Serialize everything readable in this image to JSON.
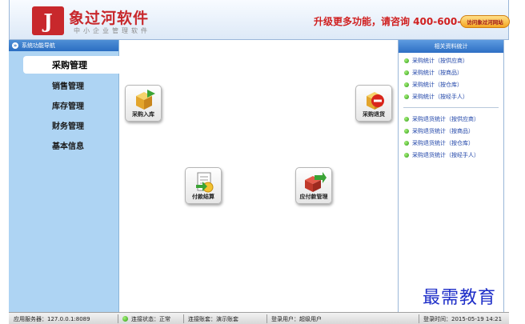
{
  "header": {
    "logo_title": "象过河软件",
    "logo_subtitle": "中小企业管理软件",
    "promo": "升级更多功能，请咨询 400-600-1168",
    "visit_button": "访问象过河网站"
  },
  "nav": {
    "header": "系统功能导航",
    "items": [
      {
        "label": "采购管理"
      },
      {
        "label": "销售管理"
      },
      {
        "label": "库存管理"
      },
      {
        "label": "财务管理"
      },
      {
        "label": "基本信息"
      }
    ]
  },
  "main": {
    "tiles": [
      {
        "label": "采购入库",
        "icon": "purchase-in-icon"
      },
      {
        "label": "采购退货",
        "icon": "purchase-return-icon"
      },
      {
        "label": "付款结算",
        "icon": "payment-settlement-icon"
      },
      {
        "label": "应付款管理",
        "icon": "accounts-payable-icon"
      }
    ]
  },
  "right_panel": {
    "title": "相关资料统计",
    "group1": [
      {
        "label": "采购统计（按供应商）"
      },
      {
        "label": "采购统计（按商品）"
      },
      {
        "label": "采购统计（按仓库）"
      },
      {
        "label": "采购统计（按经手人）"
      }
    ],
    "group2": [
      {
        "label": "采购退货统计（按供应商）"
      },
      {
        "label": "采购退货统计（按商品）"
      },
      {
        "label": "采购退货统计（按仓库）"
      },
      {
        "label": "采购退货统计（按经手人）"
      }
    ]
  },
  "watermark": "最需教育",
  "statusbar": {
    "server": "应用服务器：127.0.0.1:8089",
    "connection": "连接状态：正常",
    "account": "连接账套：演示账套",
    "user": "登录用户：超级用户",
    "login_time": "登录时间：2015-05-19 14:21"
  },
  "colors": {
    "brand_red": "#c8282c",
    "nav_bg": "#aed4f3",
    "header_blue": "#2b6ec2",
    "link_blue": "#1f44a8"
  }
}
